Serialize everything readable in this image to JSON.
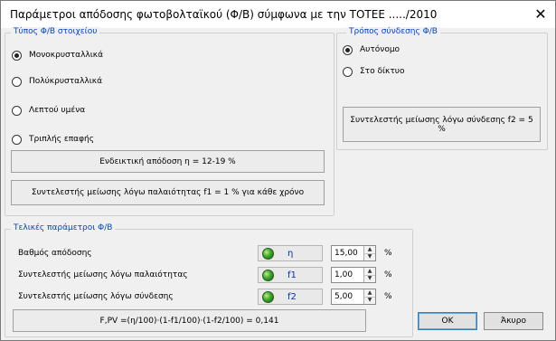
{
  "window": {
    "title": "Παράμετροι απόδοσης  φωτοβολταϊκού (Φ/Β)  σύμφωνα με την ΤΟΤΕΕ ...../2010",
    "close_glyph": "✕"
  },
  "panel_type": {
    "title": "Τύπος Φ/Β στοιχείου",
    "options": [
      {
        "label": "Μονοκρυσταλλικά",
        "checked": true
      },
      {
        "label": "Πολύκρυσταλλικά",
        "checked": false
      },
      {
        "label": "Λεπτού υμένα",
        "checked": false
      },
      {
        "label": "Τριπλής επαφής",
        "checked": false
      }
    ],
    "indicative_efficiency": "Ενδεικτική απόδοση η = 12-19 %",
    "aging_factor_note": "Συντελεστής μείωσης λόγω παλαιότητας f1 = 1 % για κάθε χρόνο"
  },
  "panel_connection": {
    "title": "Τρόπος σύνδεσης Φ/Β",
    "options": [
      {
        "label": "Αυτόνομο",
        "checked": true
      },
      {
        "label": "Στο δίκτυο",
        "checked": false
      }
    ],
    "connection_factor_note": "Συντελεστής μείωσης λόγω σύνδεσης f2 = 5 %"
  },
  "panel_final": {
    "title": "Τελικές παράμετροι Φ/Β",
    "rows": [
      {
        "label": "Βαθμός απόδοσης",
        "symbol": "η",
        "value": "15,00",
        "unit": "%",
        "indicator_color": "#3fa82a"
      },
      {
        "label": "Συντελεστής μείωσης λόγω παλαιότητας",
        "symbol": "f1",
        "value": "1,00",
        "unit": "%",
        "indicator_color": "#3fa82a"
      },
      {
        "label": "Συντελεστής μείωσης λόγω σύνδεσης",
        "symbol": "f2",
        "value": "5,00",
        "unit": "%",
        "indicator_color": "#3fa82a"
      }
    ],
    "formula": "F,PV =(η/100)·(1-f1/100)·(1-f2/100) = 0,141"
  },
  "buttons": {
    "ok": "OK",
    "cancel": "Άκυρο"
  },
  "colors": {
    "group_title": "#0044cc",
    "led_green": "#3fa82a",
    "symbol_blue": "#0033aa"
  }
}
